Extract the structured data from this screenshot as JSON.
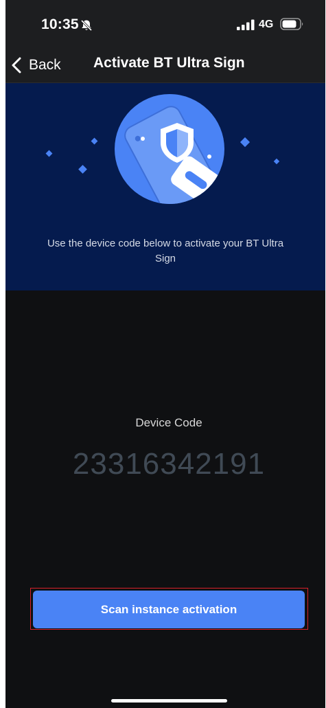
{
  "status_bar": {
    "time": "10:35",
    "network": "4G",
    "icons": [
      "bell-slash-icon",
      "signal-icon",
      "battery-icon"
    ]
  },
  "nav": {
    "back_label": "Back",
    "title": "Activate BT Ultra Sign",
    "icon": "chevron-left-icon"
  },
  "hero": {
    "illustration": "shield-phone-illustration",
    "instruction": "Use the device code below to activate your BT Ultra Sign"
  },
  "device_code": {
    "label": "Device Code",
    "value": "23316342191"
  },
  "actions": {
    "scan_label": "Scan instance activation"
  },
  "colors": {
    "accent": "#4a83f5",
    "hero_background": "#051b4e",
    "screen_background": "#0f1012",
    "bar_background": "#1d1e20",
    "code_text": "#404a55",
    "highlight_outline": "#d9202a"
  }
}
